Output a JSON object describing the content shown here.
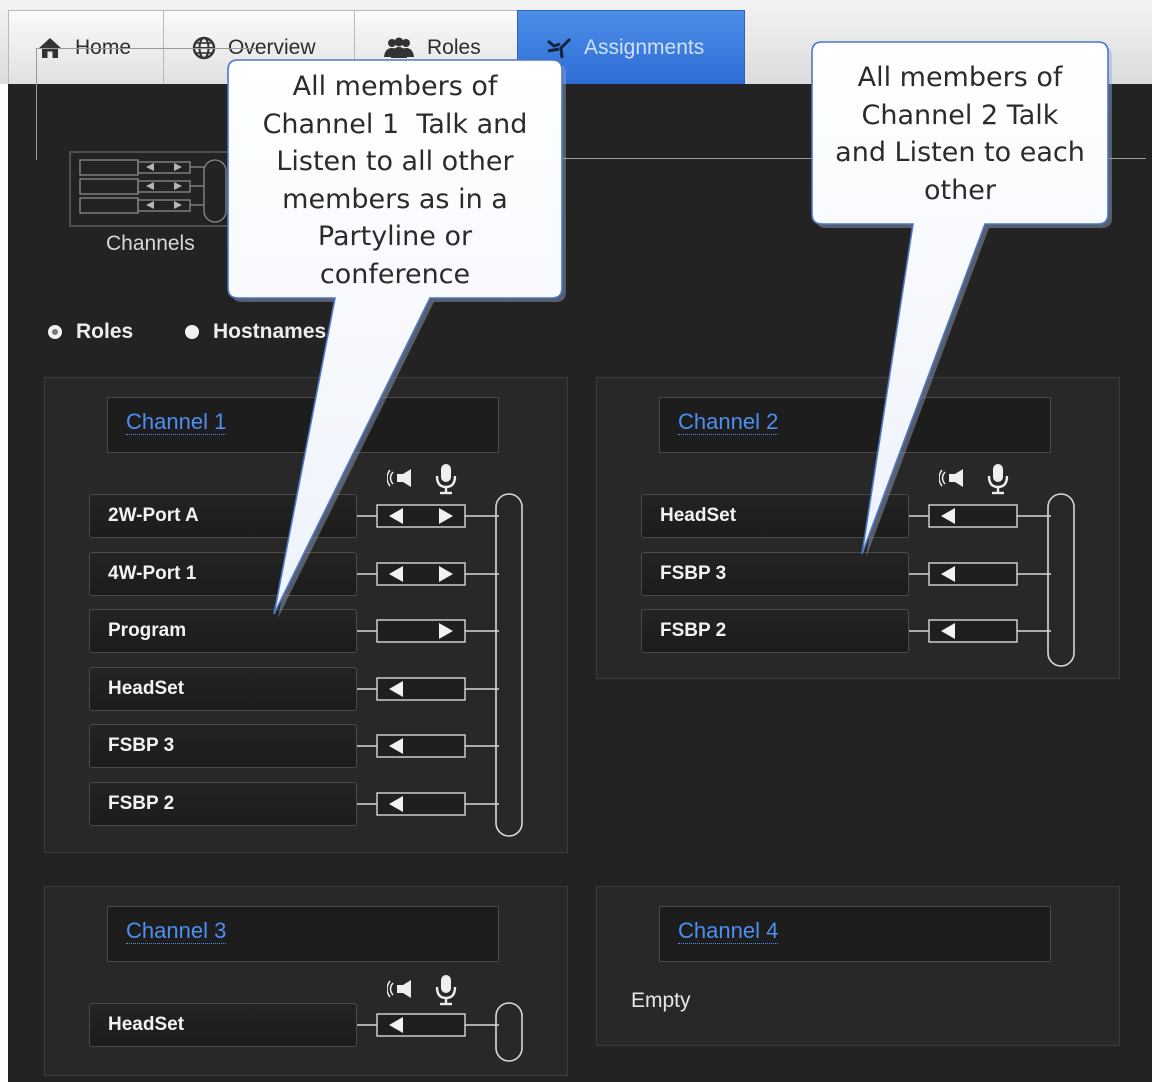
{
  "tabs": [
    {
      "label": "Home",
      "icon": "home-icon",
      "active": false
    },
    {
      "label": "Overview",
      "icon": "globe-icon",
      "active": false
    },
    {
      "label": "Roles",
      "icon": "users-icon",
      "active": false
    },
    {
      "label": "Assignments",
      "icon": "assignments-icon",
      "active": true
    }
  ],
  "toolbar": {
    "channels_label": "Channels"
  },
  "view_options": [
    {
      "label": "Roles",
      "selected": true
    },
    {
      "label": "Hostnames",
      "selected": false
    }
  ],
  "channels": [
    {
      "title": "Channel 1",
      "members": [
        {
          "name": "2W-Port A",
          "listen": true,
          "talk": true
        },
        {
          "name": "4W-Port 1",
          "listen": true,
          "talk": true
        },
        {
          "name": "Program",
          "listen": false,
          "talk": true
        },
        {
          "name": "HeadSet",
          "listen": true,
          "talk": false
        },
        {
          "name": "FSBP 3",
          "listen": true,
          "talk": false
        },
        {
          "name": "FSBP 2",
          "listen": true,
          "talk": false
        }
      ]
    },
    {
      "title": "Channel 2",
      "members": [
        {
          "name": "HeadSet",
          "listen": true,
          "talk": false
        },
        {
          "name": "FSBP 3",
          "listen": true,
          "talk": false
        },
        {
          "name": "FSBP 2",
          "listen": true,
          "talk": false
        }
      ]
    },
    {
      "title": "Channel 3",
      "members": [
        {
          "name": "HeadSet",
          "listen": true,
          "talk": false
        }
      ]
    },
    {
      "title": "Channel 4",
      "members": [],
      "empty_text": "Empty"
    }
  ],
  "column_icons": [
    "speaker-icon",
    "microphone-icon"
  ],
  "callouts": [
    {
      "lines": [
        "All members of",
        "Channel 1  Talk and",
        "Listen to all other",
        "members as in a",
        "Partyline or",
        "conference"
      ]
    },
    {
      "lines": [
        "All members of",
        "Channel 2 Talk",
        "and Listen to each",
        "other"
      ]
    }
  ],
  "colors": {
    "accent": "#2e6dd4",
    "channel_title": "#4d8ef0",
    "background": "#232323"
  }
}
